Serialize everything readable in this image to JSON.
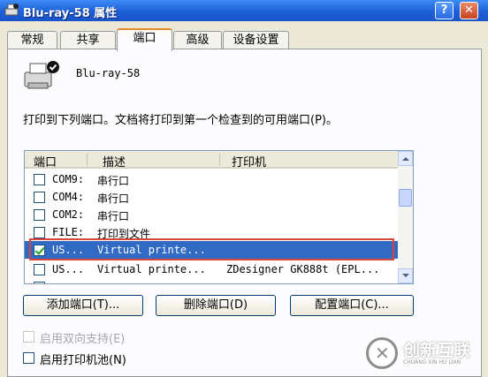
{
  "window": {
    "title": "Blu-ray-58 属性",
    "help_label": "?",
    "close_label": "✕"
  },
  "tabs": [
    {
      "label": "常规"
    },
    {
      "label": "共享"
    },
    {
      "label": "端口"
    },
    {
      "label": "高级"
    },
    {
      "label": "设备设置"
    }
  ],
  "printer": {
    "name": "Blu-ray-58"
  },
  "instruction": "打印到下列端口。文档将打印到第一个检查到的可用端口(P)。",
  "port_list": {
    "headers": [
      "端口",
      "描述",
      "打印机"
    ],
    "rows": [
      {
        "port": "COM9:",
        "desc": "串行口",
        "printer": "",
        "checked": false
      },
      {
        "port": "COM4:",
        "desc": "串行口",
        "printer": "",
        "checked": false
      },
      {
        "port": "COM2:",
        "desc": "串行口",
        "printer": "",
        "checked": false
      },
      {
        "port": "FILE:",
        "desc": "打印到文件",
        "printer": "",
        "checked": false
      },
      {
        "port": "US...",
        "desc": "Virtual printe...",
        "printer": "",
        "checked": true
      },
      {
        "port": "US...",
        "desc": "Virtual printe...",
        "printer": "ZDesigner GK888t (EPL...",
        "checked": false
      }
    ]
  },
  "buttons": {
    "add_port": "添加端口(T)...",
    "delete_port": "删除端口(D)",
    "config_port": "配置端口(C)..."
  },
  "options": {
    "bidirectional": "启用双向支持(E)",
    "pooling": "启用打印机池(N)"
  },
  "watermark": {
    "brand": "创新互联",
    "sub": "CHUANG XIN HU LIAN"
  },
  "colors": {
    "titlebar": "#1c5fd8",
    "selection": "#316ac5",
    "highlight_border": "#d9453a",
    "active_tab_top": "#e68b2c"
  }
}
